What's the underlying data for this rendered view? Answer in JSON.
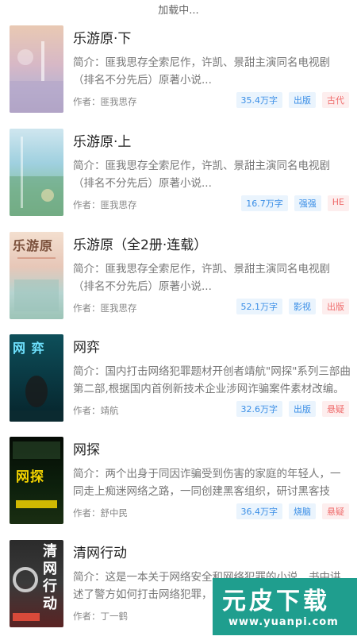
{
  "status": {
    "loading": "加载中..."
  },
  "books": [
    {
      "title": "乐游原·下",
      "desc": "简介：匪我思存全索尼作，许凯、景甜主演同名电视剧（排名不分先后）原著小说...",
      "author": "作者：匪我思存",
      "tags": [
        "35.4万字",
        "出版",
        "古代"
      ],
      "cover_text": ""
    },
    {
      "title": "乐游原·上",
      "desc": "简介：匪我思存全索尼作，许凯、景甜主演同名电视剧（排名不分先后）原著小说...",
      "author": "作者：匪我思存",
      "tags": [
        "16.7万字",
        "强强",
        "HE"
      ],
      "cover_text": ""
    },
    {
      "title": "乐游原（全2册·连载）",
      "desc": "简介：匪我思存全索尼作，许凯、景甜主演同名电视剧（排名不分先后）原著小说...",
      "author": "作者：匪我思存",
      "tags": [
        "52.1万字",
        "影视",
        "出版"
      ],
      "cover_text": "乐游原"
    },
    {
      "title": "网弈",
      "desc": "简介：国内打击网络犯罪题材开创者靖航\"网探\"系列三部曲第二部,根据国内首例新技术企业涉网诈骗案件素材改编。放...",
      "author": "作者：靖航",
      "tags": [
        "32.6万字",
        "出版",
        "悬疑"
      ],
      "cover_text": "网 弈"
    },
    {
      "title": "网探",
      "desc": "简介：两个出身于同因诈骗受到伤害的家庭的年轻人，一同走上痴迷网络之路，一同创建黑客组织，研讨黑客技术。但...",
      "author": "作者：舒中民",
      "tags": [
        "36.4万字",
        "烧脑",
        "悬疑"
      ],
      "cover_text": "网探"
    },
    {
      "title": "清网行动",
      "desc": "简介：这是一本关于网络安全和网络犯罪的小说，书中讲述了警方如何打击网络犯罪，保护",
      "author": "作者：丁一鹤",
      "tags": [],
      "cover_text": "清网行动"
    }
  ],
  "watermark": {
    "logo": "元皮下载",
    "url": "www.yuanpi.com"
  }
}
